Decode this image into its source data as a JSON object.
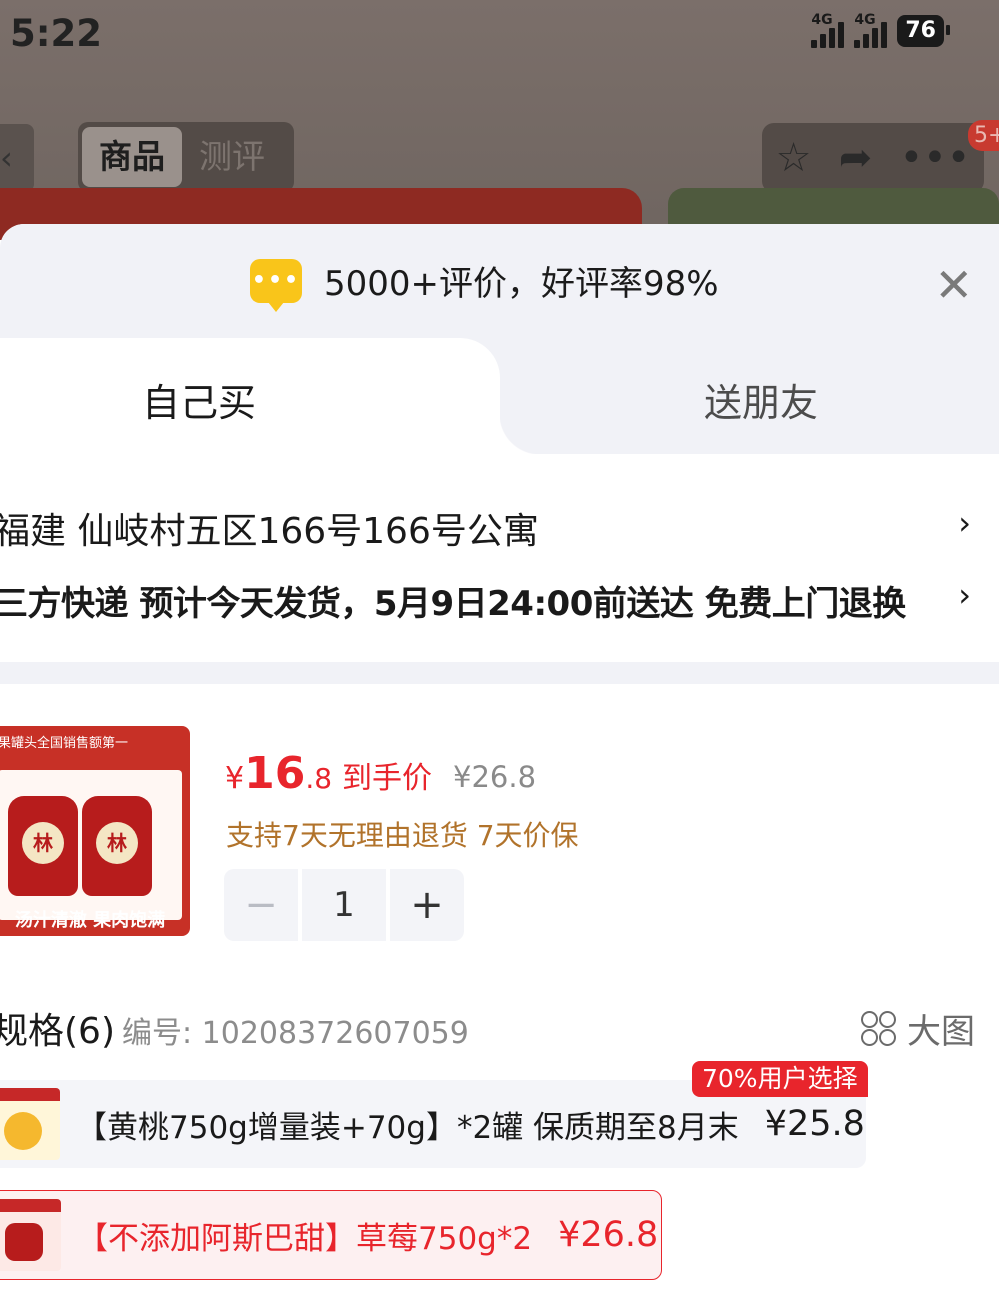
{
  "status_bar": {
    "time": "5:22",
    "net1": "4G",
    "net2": "4G",
    "battery": "76"
  },
  "header": {
    "back": "‹",
    "tabs": [
      "商品",
      "测评"
    ],
    "cart_badge": "5+"
  },
  "notice": {
    "text": "5000+评价，好评率98%"
  },
  "buy_tabs": {
    "self": "自己买",
    "gift": "送朋友"
  },
  "address": {
    "text": "福建  仙岐村五区166号166号公寓"
  },
  "shipping": {
    "text": "三方快递 预计今天发货，5月9日24:00前送达 免费上门退换"
  },
  "product": {
    "image_top_text": "果罐头全国销售额第一",
    "image_caption": "汤汁清澈 果肉饱满",
    "currency": "¥",
    "price_int": "16",
    "price_dec": ".8",
    "price_label": "到手价",
    "original_price": "¥26.8",
    "services": "支持7天无理由退货  7天价保",
    "quantity": "1",
    "minus": "−",
    "plus": "+"
  },
  "spec": {
    "title": "规格(6)",
    "number": "编号: 10208372607059",
    "big_pic": "大图",
    "popular_tag": "70%用户选择",
    "options": [
      {
        "label": "【黄桃750g增量装+70g】*2罐 保质期至8月末",
        "price": "¥25.8",
        "selected": false
      },
      {
        "label": "【不添加阿斯巴甜】草莓750g*2",
        "price": "¥26.8",
        "selected": true
      }
    ]
  },
  "colors": {
    "accent": "#e8252c",
    "service": "#b1732b",
    "sheet_header": "#f1f2f7"
  }
}
